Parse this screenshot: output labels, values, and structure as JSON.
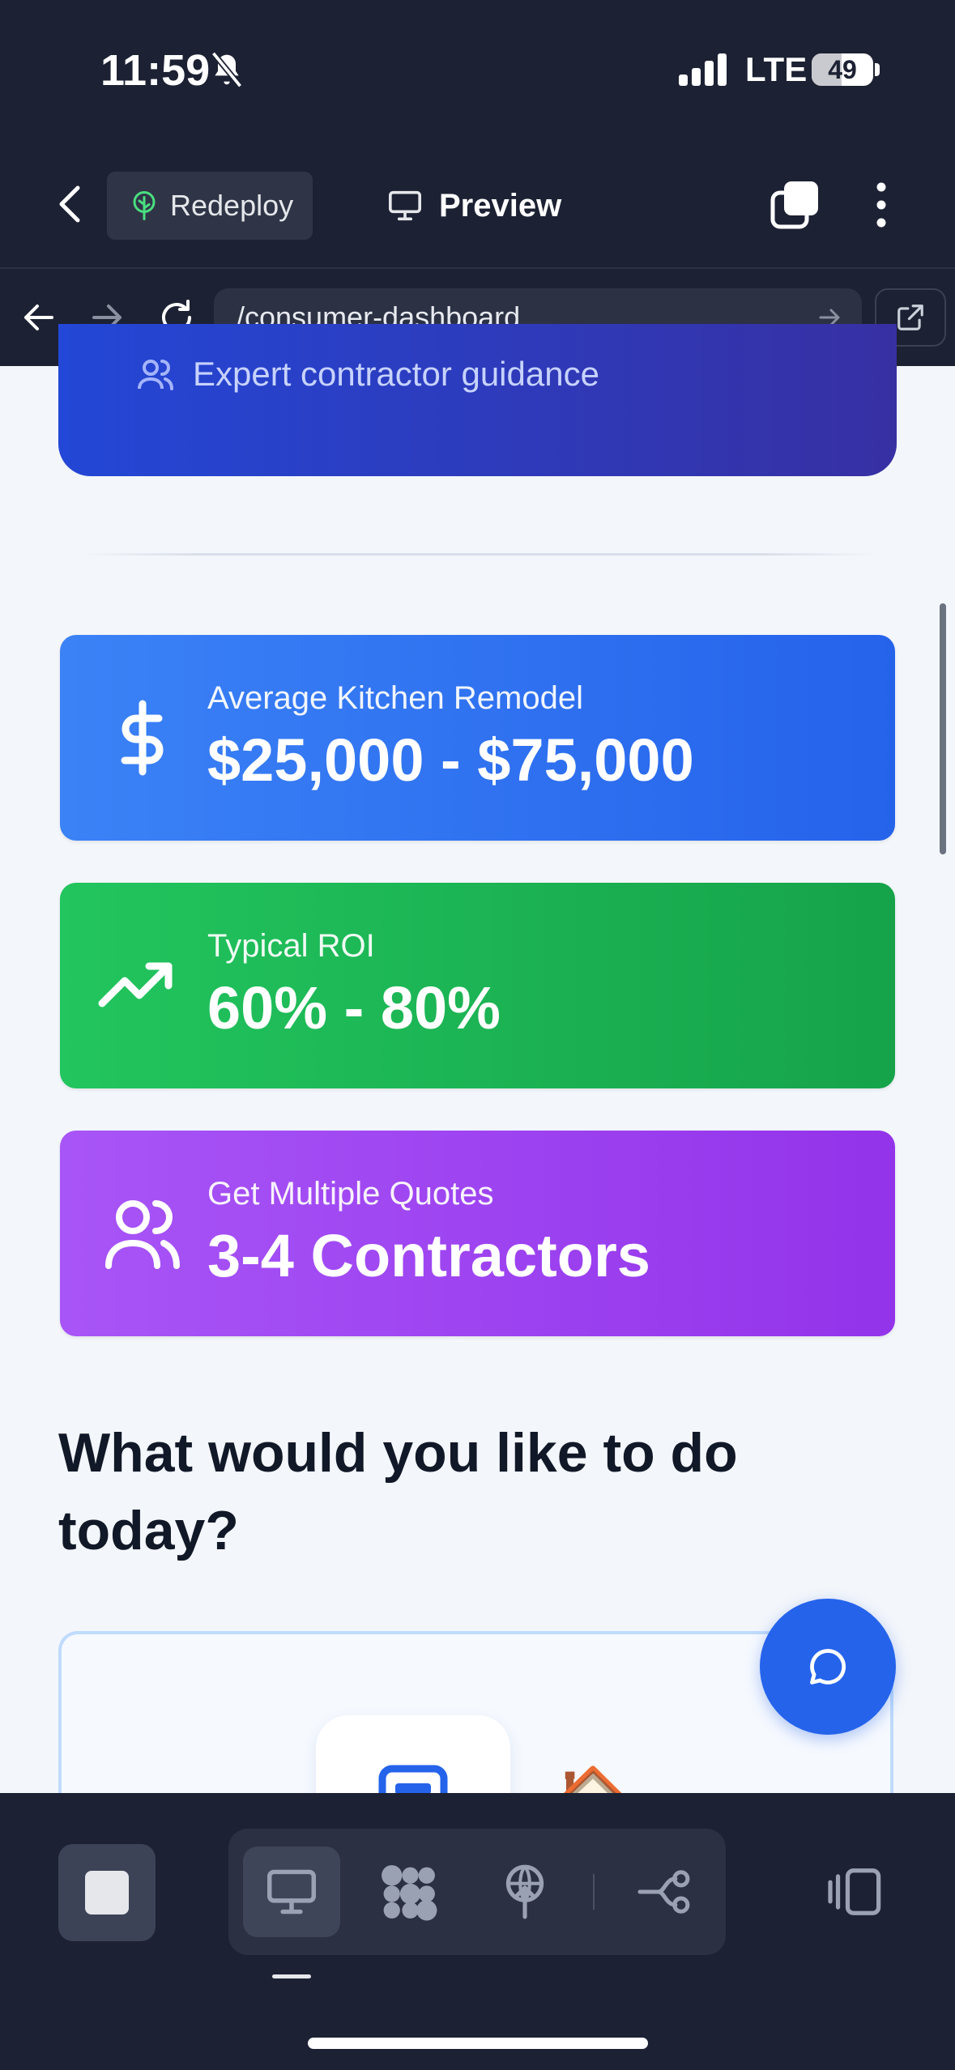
{
  "status_bar": {
    "time": "11:59",
    "network": "LTE",
    "battery": "49",
    "battery_level": 0.49
  },
  "toolbar": {
    "redeploy_label": "Redeploy",
    "preview_label": "Preview"
  },
  "browser": {
    "url": "/consumer-dashboard"
  },
  "hero": {
    "feature_text": "Expert contractor guidance"
  },
  "stats": [
    {
      "label": "Average Kitchen Remodel",
      "value": "$25,000 - $75,000",
      "icon": "dollar-icon",
      "color": "#3b82f6"
    },
    {
      "label": "Typical ROI",
      "value": "60% - 80%",
      "icon": "trending-up-icon",
      "color": "#22c55e"
    },
    {
      "label": "Get Multiple Quotes",
      "value": "3-4 Contractors",
      "icon": "users-icon",
      "color": "#a855f7"
    }
  ],
  "section": {
    "heading": "What would you like to do today?"
  },
  "action_card": {
    "icon": "document-icon",
    "emoji": "🏠"
  },
  "bottom_bar": {
    "modes": [
      "preview-mode",
      "design-mode",
      "deploy-mode",
      "workflow-mode"
    ],
    "active_mode": "preview-mode"
  },
  "colors": {
    "chrome": "#1c2133",
    "accent": "#2563eb",
    "page_bg": "#f3f6fb"
  }
}
